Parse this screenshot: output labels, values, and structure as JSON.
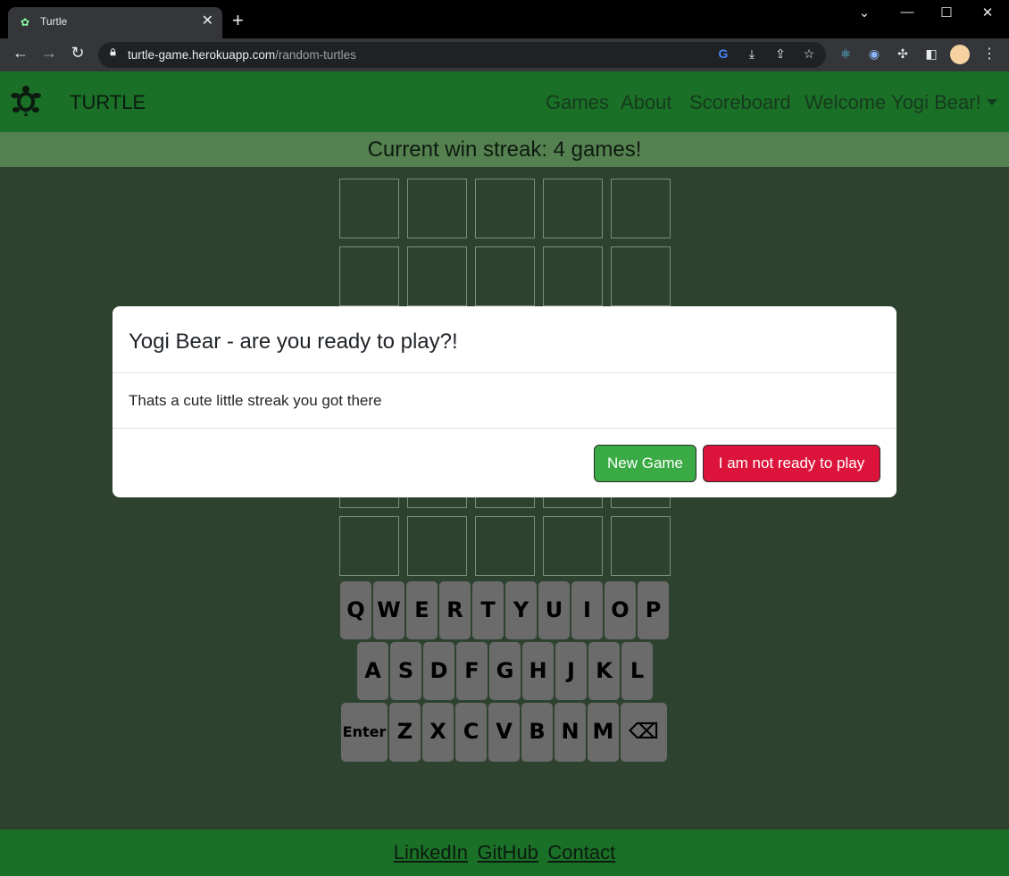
{
  "browser": {
    "tab_title": "Turtle",
    "url_host": "turtle-game.herokuapp.com",
    "url_path": "/random-turtles"
  },
  "navbar": {
    "brand": "TURTLE",
    "links": [
      "Games",
      "About",
      "Scoreboard",
      "Welcome Yogi Bear!"
    ]
  },
  "streak": {
    "text": "Current win streak: 4 games!"
  },
  "keyboard": {
    "row1": [
      "Q",
      "W",
      "E",
      "R",
      "T",
      "Y",
      "U",
      "I",
      "O",
      "P"
    ],
    "row2": [
      "A",
      "S",
      "D",
      "F",
      "G",
      "H",
      "J",
      "K",
      "L"
    ],
    "row3": [
      "Enter",
      "Z",
      "X",
      "C",
      "V",
      "B",
      "N",
      "M",
      "⌫"
    ]
  },
  "modal": {
    "title": "Yogi Bear - are you ready to play?!",
    "body": "Thats a cute little streak you got there",
    "new_game_label": "New Game",
    "not_ready_label": "I am not ready to play"
  },
  "footer": {
    "links": [
      "LinkedIn",
      "GitHub",
      "Contact"
    ]
  },
  "colors": {
    "navbar": "#1b7028",
    "page_bg": "#2e4230",
    "streak_bar": "#558150",
    "new_game": "#3aaa44",
    "not_ready": "#dc143c"
  }
}
